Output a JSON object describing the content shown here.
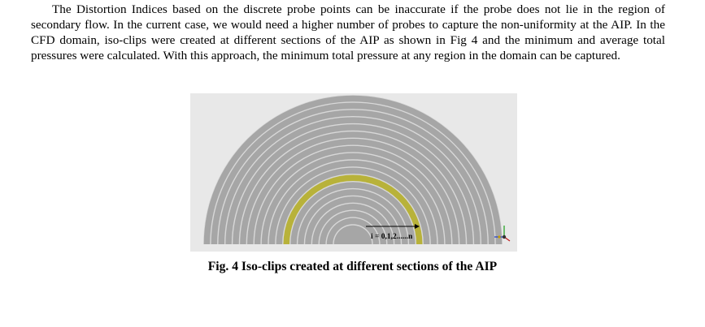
{
  "paragraph": {
    "text": "The Distortion Indices based on the discrete probe points can be inaccurate if the probe does not lie in the region of secondary flow. In the current case, we would need a higher number of probes to capture the non-uniformity at the AIP. In the CFD domain, iso-clips were created at different sections of the AIP as shown in Fig 4 and the minimum and average total pressures were calculated. With this approach, the minimum total pressure at any region in the domain can be captured."
  },
  "figure": {
    "arrow_label": "i = 0,1,2......n",
    "ring_count": 18,
    "highlighted_ring_index": 11,
    "colors": {
      "background": "#e8e8e8",
      "ring_fill": "#a6a6a6",
      "ring_gap": "#d8d8d8",
      "highlight": "#b8b23a"
    },
    "axis_icon": "axis-triad-icon"
  },
  "caption": {
    "text": "Fig. 4  Iso-clips created at different sections of the AIP"
  }
}
